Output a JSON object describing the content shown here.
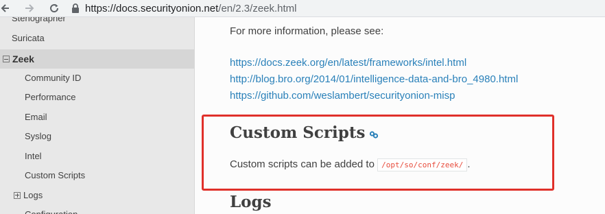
{
  "browser": {
    "url_host": "https://docs.securityonion.net",
    "url_path": "/en/2.3/zeek.html"
  },
  "sidebar": {
    "items": [
      {
        "label": "Stenographer"
      },
      {
        "label": "Suricata"
      },
      {
        "label": "Zeek"
      },
      {
        "label": "Community ID"
      },
      {
        "label": "Performance"
      },
      {
        "label": "Email"
      },
      {
        "label": "Syslog"
      },
      {
        "label": "Intel"
      },
      {
        "label": "Custom Scripts"
      },
      {
        "label": "Logs"
      },
      {
        "label": "Configuration"
      }
    ]
  },
  "main": {
    "more_info": "For more information, please see:",
    "links": [
      "https://docs.zeek.org/en/latest/frameworks/intel.html",
      "http://blog.bro.org/2014/01/intelligence-data-and-bro_4980.html",
      "https://github.com/weslambert/securityonion-misp"
    ],
    "custom_scripts_heading": "Custom Scripts",
    "custom_scripts_text": "Custom scripts can be added to",
    "custom_scripts_path": "/opt/so/conf/zeek/",
    "custom_scripts_end": ".",
    "logs_heading": "Logs"
  },
  "colors": {
    "link": "#2980b9",
    "highlight_border": "#e0302a",
    "code": "#e74c3c"
  }
}
